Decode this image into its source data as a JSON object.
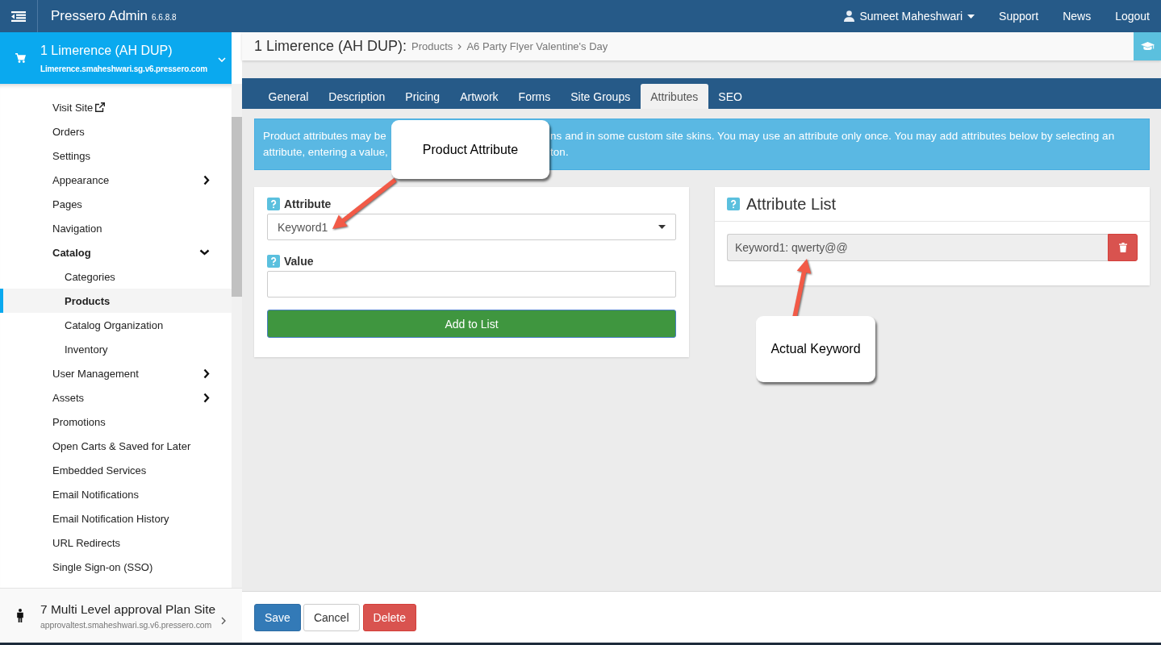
{
  "topbar": {
    "title": "Pressero Admin",
    "version": "6.6.8.8",
    "user": "Sumeet Maheshwari",
    "links": [
      "Support",
      "News",
      "Logout"
    ]
  },
  "sidebar": {
    "current_site": {
      "name": "1 Limerence (AH DUP)",
      "url": "Limerence.smaheshwari.sg.v6.pressero.com",
      "expanded": true
    },
    "items": [
      {
        "label": "Visit Site",
        "kind": "external",
        "selected": false
      },
      {
        "label": "Orders",
        "kind": "link",
        "selected": false
      },
      {
        "label": "Settings",
        "kind": "link",
        "selected": false
      },
      {
        "label": "Appearance",
        "kind": "group",
        "expanded": false,
        "selected": false
      },
      {
        "label": "Pages",
        "kind": "link",
        "selected": false
      },
      {
        "label": "Navigation",
        "kind": "link",
        "selected": false
      },
      {
        "label": "Catalog",
        "kind": "group",
        "expanded": true,
        "selected": false,
        "children": [
          {
            "label": "Categories",
            "kind": "link",
            "selected": false
          },
          {
            "label": "Products",
            "kind": "link",
            "selected": true
          },
          {
            "label": "Catalog Organization",
            "kind": "link",
            "selected": false
          },
          {
            "label": "Inventory",
            "kind": "link",
            "selected": false
          }
        ]
      },
      {
        "label": "User Management",
        "kind": "group",
        "expanded": false,
        "selected": false
      },
      {
        "label": "Assets",
        "kind": "group",
        "expanded": false,
        "selected": false
      },
      {
        "label": "Promotions",
        "kind": "link",
        "selected": false
      },
      {
        "label": "Open Carts & Saved for Later",
        "kind": "link",
        "selected": false
      },
      {
        "label": "Embedded Services",
        "kind": "link",
        "selected": false
      },
      {
        "label": "Email Notifications",
        "kind": "link",
        "selected": false
      },
      {
        "label": "Email Notification History",
        "kind": "link",
        "selected": false
      },
      {
        "label": "URL Redirects",
        "kind": "link",
        "selected": false
      },
      {
        "label": "Single Sign-on (SSO)",
        "kind": "link",
        "selected": false
      }
    ],
    "other_sites": [
      {
        "name": "7 Multi Level approval Plan Site",
        "url": "approvaltest.smaheshwari.sg.v6.pressero.com"
      }
    ]
  },
  "page_header": {
    "title": "1 Limerence (AH DUP):",
    "breadcrumb": [
      "Products",
      "A6 Party Flyer Valentine's Day"
    ]
  },
  "tabs": [
    {
      "label": "General",
      "selected": false
    },
    {
      "label": "Description",
      "selected": false
    },
    {
      "label": "Pricing",
      "selected": false
    },
    {
      "label": "Artwork",
      "selected": false
    },
    {
      "label": "Forms",
      "selected": false
    },
    {
      "label": "Site Groups",
      "selected": false
    },
    {
      "label": "Attributes",
      "selected": true
    },
    {
      "label": "SEO",
      "selected": false
    }
  ],
  "info_banner": {
    "lines": [
      {
        "left": "Product attributes may be",
        "right": "ns and in some custom site skins. You may use an attribute only once. You may add attributes below by selecting an"
      },
      {
        "left": "attribute, entering a value,",
        "right": "ton."
      }
    ]
  },
  "attribute_form": {
    "fields": [
      {
        "kind": "select",
        "label": "Attribute",
        "value": "Keyword1"
      },
      {
        "kind": "input",
        "label": "Value"
      }
    ],
    "button": "Add to List"
  },
  "attribute_list": {
    "title": "Attribute List",
    "items": [
      {
        "text": "Keyword1: qwerty@@"
      }
    ]
  },
  "actions": [
    {
      "label": "Save",
      "kind": "primary"
    },
    {
      "label": "Cancel",
      "kind": "default"
    },
    {
      "label": "Delete",
      "kind": "danger"
    }
  ],
  "annotations": [
    {
      "text": "Product Attribute"
    },
    {
      "text": "Actual Keyword"
    }
  ]
}
